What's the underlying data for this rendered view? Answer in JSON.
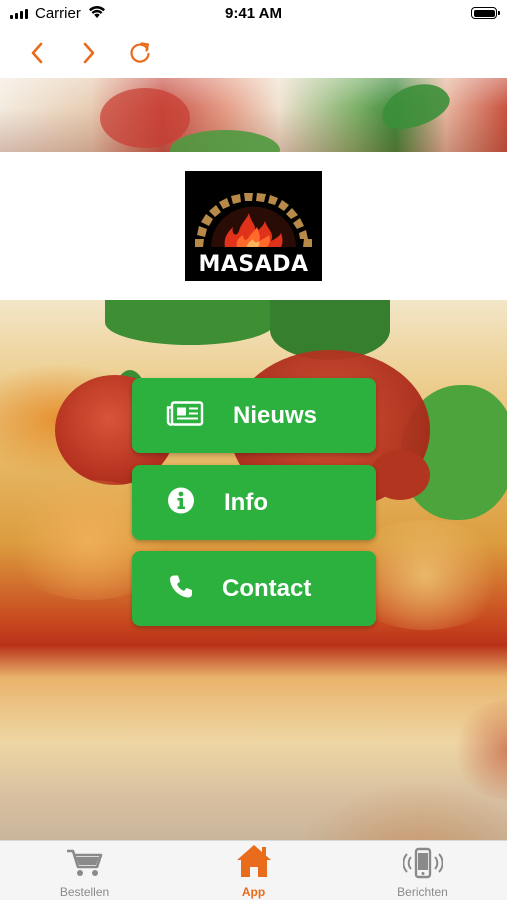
{
  "status_bar": {
    "carrier": "Carrier",
    "time": "9:41 AM",
    "battery_level": 1.0
  },
  "nav": {
    "back_icon": "chevron-left-icon",
    "forward_icon": "chevron-right-icon",
    "reload_icon": "reload-icon",
    "accent_color": "#e86c1c"
  },
  "logo": {
    "text": "MASADA",
    "logo_icon": "wood-fired-oven-logo"
  },
  "menu": {
    "button_color": "#2cb13f",
    "items": [
      {
        "label": "Nieuws",
        "icon": "newspaper-icon"
      },
      {
        "label": "Info",
        "icon": "info-icon"
      },
      {
        "label": "Contact",
        "icon": "phone-icon"
      }
    ]
  },
  "tab_bar": {
    "items": [
      {
        "label": "Bestellen",
        "icon": "cart-icon",
        "active": false
      },
      {
        "label": "App",
        "icon": "home-icon",
        "active": true
      },
      {
        "label": "Berichten",
        "icon": "phone-message-icon",
        "active": false
      }
    ],
    "active_color": "#e86c1c",
    "inactive_color": "#8a8a8a"
  }
}
